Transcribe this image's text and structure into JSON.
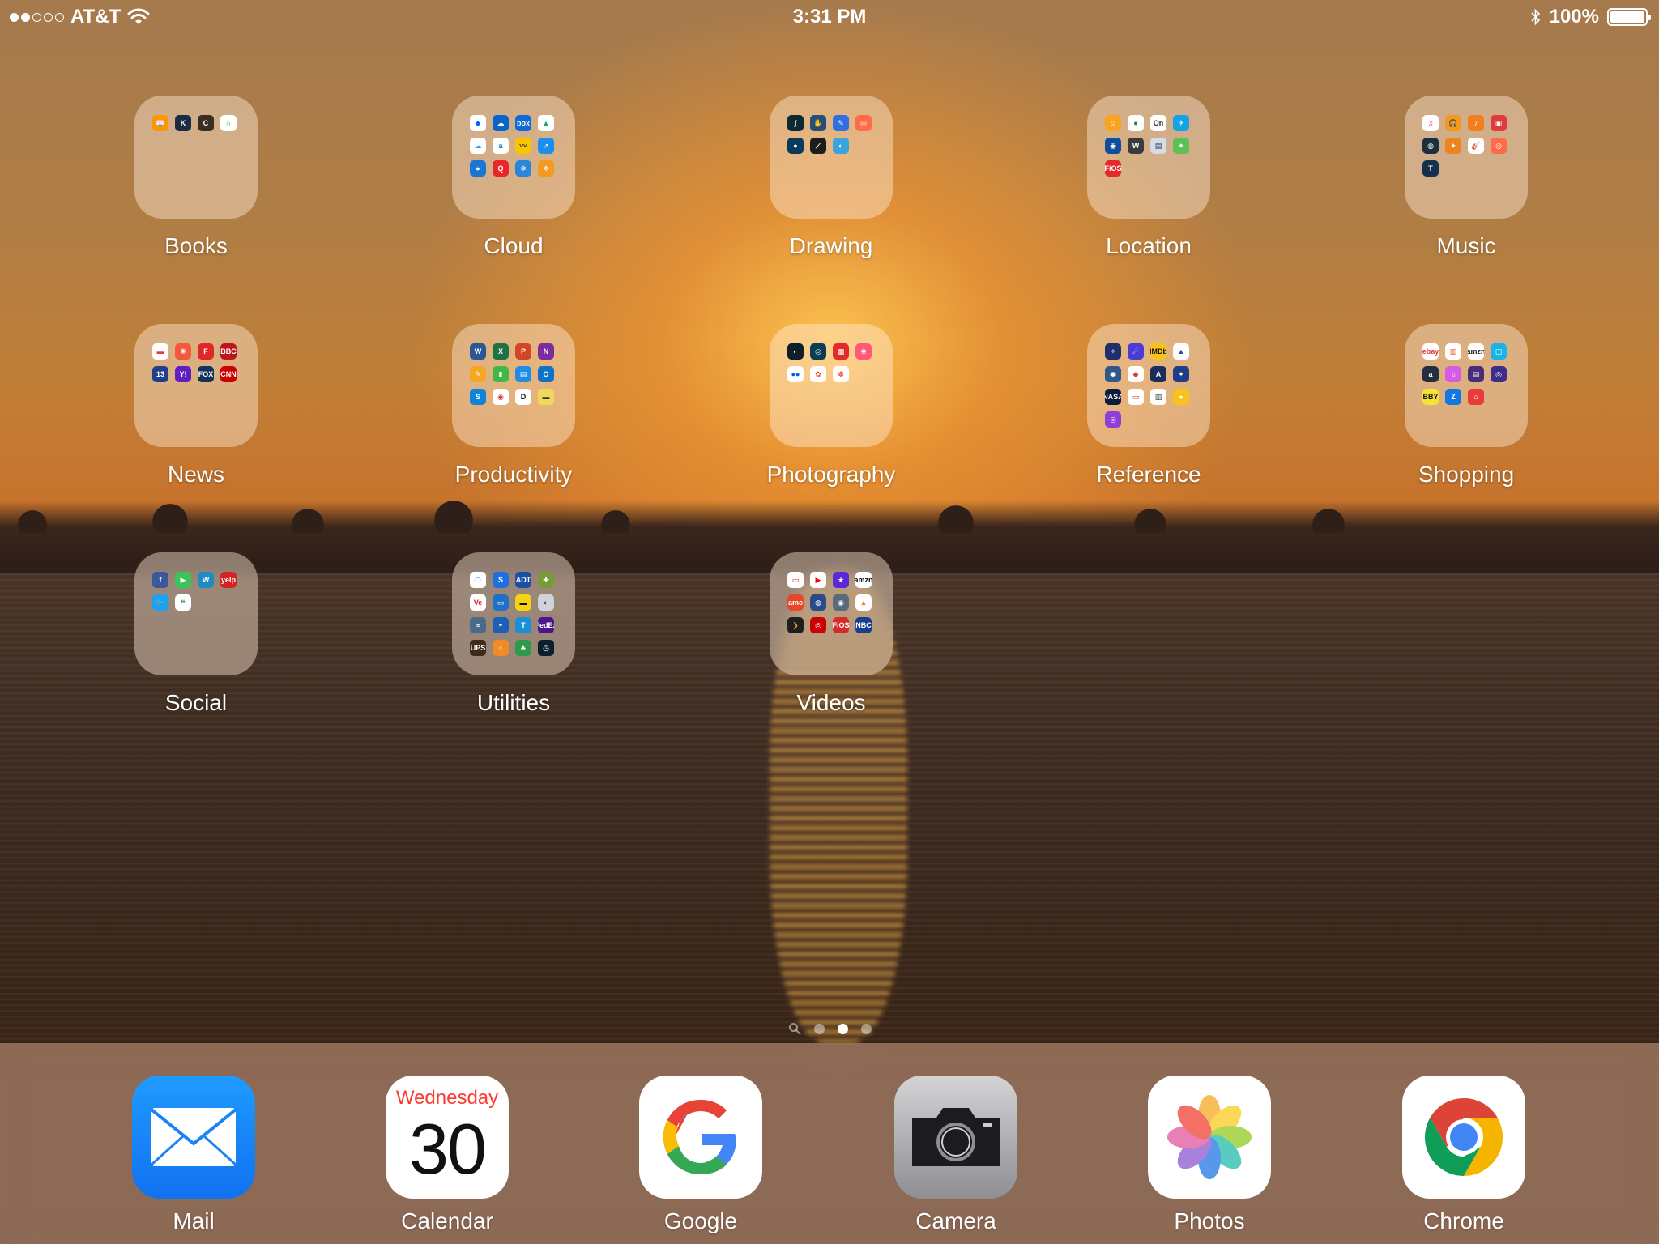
{
  "status_bar": {
    "carrier": "AT&T",
    "time": "3:31 PM",
    "battery": "100%",
    "signal_bars_filled": 2,
    "signal_bars_total": 5
  },
  "folders": [
    {
      "label": "Books",
      "apps": [
        {
          "icon": "books-icon",
          "color": "#ff9500",
          "glyph": "📖"
        },
        {
          "icon": "kindle-icon",
          "color": "#1a2b46",
          "glyph": "K"
        },
        {
          "icon": "comics-icon",
          "color": "#3a2e22",
          "glyph": "C"
        },
        {
          "icon": "nook-icon",
          "color": "#ffffff",
          "fg": "#39a34a",
          "glyph": "∩"
        }
      ]
    },
    {
      "label": "Cloud",
      "apps": [
        {
          "icon": "dropbox-icon",
          "color": "#ffffff",
          "fg": "#0061ff",
          "glyph": "◆"
        },
        {
          "icon": "onedrive-icon",
          "color": "#0a64c8",
          "glyph": "☁"
        },
        {
          "icon": "box-icon",
          "color": "#0e6bd6",
          "glyph": "box"
        },
        {
          "icon": "google-drive-icon",
          "color": "#ffffff",
          "fg": "#1da462",
          "glyph": "▲"
        },
        {
          "icon": "icloud-drive-icon",
          "color": "#ffffff",
          "fg": "#3a9bf4",
          "glyph": "☁"
        },
        {
          "icon": "amazon-drive-icon",
          "color": "#ffffff",
          "fg": "#0d79c6",
          "glyph": "a"
        },
        {
          "icon": "mega-icon",
          "color": "#fbc400",
          "fg": "#333",
          "glyph": "〰"
        },
        {
          "icon": "arrow-cloud-icon",
          "color": "#1b8ef0",
          "glyph": "➚"
        },
        {
          "icon": "leaf-icon",
          "color": "#1976d2",
          "glyph": "●"
        },
        {
          "icon": "quip-icon",
          "color": "#e8262c",
          "glyph": "Q"
        },
        {
          "icon": "snowflake-icon",
          "color": "#2a86d9",
          "glyph": "❄"
        },
        {
          "icon": "gear-sync-icon",
          "color": "#f49a23",
          "glyph": "✲"
        }
      ]
    },
    {
      "label": "Drawing",
      "apps": [
        {
          "icon": "adobe-draw-icon",
          "color": "#0b2a33",
          "glyph": "∫"
        },
        {
          "icon": "sketch-icon",
          "color": "#264f78",
          "glyph": "✋"
        },
        {
          "icon": "pencil-icon",
          "color": "#2f6fe0",
          "glyph": "✎"
        },
        {
          "icon": "art-icon",
          "color": "#ff6d48",
          "glyph": "◎"
        },
        {
          "icon": "pin-icon",
          "color": "#0a3a5a",
          "glyph": "●"
        },
        {
          "icon": "brush-icon",
          "color": "#1c1c1c",
          "glyph": "⟋"
        },
        {
          "icon": "paint-icon",
          "color": "#3aa3e0",
          "glyph": "◐"
        }
      ]
    },
    {
      "label": "Location",
      "apps": [
        {
          "icon": "family-icon",
          "color": "#f7a520",
          "glyph": "☺"
        },
        {
          "icon": "find-friends-icon",
          "color": "#ffffff",
          "fg": "#1b8a2a",
          "glyph": "●"
        },
        {
          "icon": "on-icon",
          "color": "#ffffff",
          "fg": "#222",
          "glyph": "On"
        },
        {
          "icon": "flight-icon",
          "color": "#15a3e8",
          "glyph": "✈"
        },
        {
          "icon": "globe-icon",
          "color": "#0f4e9a",
          "glyph": "◉"
        },
        {
          "icon": "waze-icon",
          "color": "#3b3b3b",
          "glyph": "W"
        },
        {
          "icon": "bus-icon",
          "color": "#d2dde8",
          "fg": "#333",
          "glyph": "▤"
        },
        {
          "icon": "maps-icon",
          "color": "#5fbf57",
          "glyph": "⌖"
        },
        {
          "icon": "myfios-icon",
          "color": "#e22a2a",
          "glyph": "FiOS"
        }
      ]
    },
    {
      "label": "Music",
      "apps": [
        {
          "icon": "music-icon",
          "color": "#ffffff",
          "fg": "#fb3c5a",
          "glyph": "♫"
        },
        {
          "icon": "headphones-icon",
          "color": "#f39a1d",
          "glyph": "🎧"
        },
        {
          "icon": "garageband-icon",
          "color": "#f47d1e",
          "glyph": "♪"
        },
        {
          "icon": "radio-icon",
          "color": "#e03a3a",
          "glyph": "▣"
        },
        {
          "icon": "speaker-icon",
          "color": "#1b2f3f",
          "glyph": "◍"
        },
        {
          "icon": "guitar-icon",
          "color": "#ec8521",
          "glyph": "✦"
        },
        {
          "icon": "guitar-tuner-icon",
          "color": "#ffffff",
          "fg": "#e64a2b",
          "glyph": "🎸"
        },
        {
          "icon": "instagram-music-icon",
          "color": "#ff6a4a",
          "glyph": "◎"
        },
        {
          "icon": "tunein-icon",
          "color": "#15304a",
          "glyph": "T"
        }
      ]
    },
    {
      "label": "News",
      "apps": [
        {
          "icon": "news-paper-icon",
          "color": "#ffffff",
          "fg": "#e53a3a",
          "glyph": "▬"
        },
        {
          "icon": "news-icon",
          "color": "#f7573b",
          "glyph": "✺"
        },
        {
          "icon": "flipboard-icon",
          "color": "#e12828",
          "glyph": "F"
        },
        {
          "icon": "bbc-news-icon",
          "color": "#bb1919",
          "glyph": "BBC"
        },
        {
          "icon": "fox13-icon",
          "color": "#1f3f8e",
          "glyph": "13"
        },
        {
          "icon": "yahoo-icon",
          "color": "#5f1ec0",
          "glyph": "Y!"
        },
        {
          "icon": "fox-news-icon",
          "color": "#10325c",
          "glyph": "FOX"
        },
        {
          "icon": "cnn-icon",
          "color": "#cc0000",
          "glyph": "CNN"
        }
      ]
    },
    {
      "label": "Productivity",
      "apps": [
        {
          "icon": "word-icon",
          "color": "#2b5797",
          "glyph": "W"
        },
        {
          "icon": "excel-icon",
          "color": "#1f7244",
          "glyph": "X"
        },
        {
          "icon": "powerpoint-icon",
          "color": "#d24625",
          "glyph": "P"
        },
        {
          "icon": "onenote-icon",
          "color": "#7b2e9b",
          "glyph": "N"
        },
        {
          "icon": "pages-icon",
          "color": "#f5a623",
          "glyph": "✎"
        },
        {
          "icon": "numbers-icon",
          "color": "#3fb845",
          "glyph": "▮"
        },
        {
          "icon": "keynote-icon",
          "color": "#1f8ce6",
          "glyph": "▤"
        },
        {
          "icon": "outlook-icon",
          "color": "#0e72c7",
          "glyph": "O"
        },
        {
          "icon": "skype-icon",
          "color": "#0e84d9",
          "glyph": "S"
        },
        {
          "icon": "speaker-deck-icon",
          "color": "#ffffff",
          "fg": "#d8262c",
          "glyph": "◉"
        },
        {
          "icon": "d-icon",
          "color": "#ffffff",
          "fg": "#111",
          "glyph": "D"
        },
        {
          "icon": "scanner-icon",
          "color": "#f0d85a",
          "fg": "#333",
          "glyph": "▬"
        }
      ]
    },
    {
      "label": "Photography",
      "apps": [
        {
          "icon": "lens-icon",
          "color": "#0d1f2a",
          "glyph": "◐"
        },
        {
          "icon": "camera-plus-icon",
          "color": "#0b3d54",
          "glyph": "◎"
        },
        {
          "icon": "photo-booth-icon",
          "color": "#e22a2a",
          "glyph": "▦"
        },
        {
          "icon": "collage-icon",
          "color": "#ff5a7a",
          "glyph": "❀"
        },
        {
          "icon": "flickr-icon",
          "color": "#ffffff",
          "fg": "#0063dc",
          "glyph": "●●"
        },
        {
          "icon": "google-photos-icon",
          "color": "#ffffff",
          "fg": "#ea4335",
          "glyph": "✿"
        },
        {
          "icon": "flower-icon",
          "color": "#ffffff",
          "fg": "#f04a2a",
          "glyph": "✽"
        }
      ]
    },
    {
      "label": "Reference",
      "apps": [
        {
          "icon": "star-walk-icon",
          "color": "#1f2f6b",
          "glyph": "✧"
        },
        {
          "icon": "space-icon",
          "color": "#4a3bd6",
          "glyph": "☄"
        },
        {
          "icon": "imdb-icon",
          "color": "#f5c518",
          "fg": "#111",
          "glyph": "IMDb"
        },
        {
          "icon": "navigation-icon",
          "color": "#ffffff",
          "fg": "#1d4e9a",
          "glyph": "▲"
        },
        {
          "icon": "planet-icon",
          "color": "#2d5a8a",
          "glyph": "◉"
        },
        {
          "icon": "car-icon",
          "color": "#ffffff",
          "fg": "#d33",
          "glyph": "◆"
        },
        {
          "icon": "astronaut-icon",
          "color": "#1c2d5c",
          "glyph": "A"
        },
        {
          "icon": "night-sky-icon",
          "color": "#1e3d8a",
          "glyph": "✦"
        },
        {
          "icon": "nasa-icon",
          "color": "#0b1c3c",
          "glyph": "NASA"
        },
        {
          "icon": "tv-guide-icon",
          "color": "#ffffff",
          "fg": "#d22",
          "glyph": "▭"
        },
        {
          "icon": "dictionary-icon",
          "color": "#ffffff",
          "fg": "#333",
          "glyph": "▥"
        },
        {
          "icon": "tips-icon",
          "color": "#f7c21a",
          "glyph": "●"
        },
        {
          "icon": "podcasts-icon",
          "color": "#8e3fd8",
          "glyph": "◎"
        }
      ]
    },
    {
      "label": "Shopping",
      "apps": [
        {
          "icon": "ebay-icon",
          "color": "#ffffff",
          "fg": "#e53238",
          "glyph": "ebay"
        },
        {
          "icon": "barcode-icon",
          "color": "#ffffff",
          "fg": "#e53",
          "glyph": "▥"
        },
        {
          "icon": "amazon-icon",
          "color": "#ffffff",
          "fg": "#222",
          "glyph": "amzn"
        },
        {
          "icon": "app-store-bag-icon",
          "color": "#1ab3e8",
          "glyph": "▢"
        },
        {
          "icon": "amazon-a-icon",
          "color": "#232f3e",
          "glyph": "a"
        },
        {
          "icon": "itunes-icon",
          "color": "#d55ae6",
          "glyph": "♫"
        },
        {
          "icon": "ticket-icon",
          "color": "#4a2d7a",
          "glyph": "▤"
        },
        {
          "icon": "shop-icon",
          "color": "#3d2c8a",
          "glyph": "◎"
        },
        {
          "icon": "best-buy-icon",
          "color": "#f5e33a",
          "fg": "#111",
          "glyph": "BBY"
        },
        {
          "icon": "zillow-icon",
          "color": "#1277e1",
          "glyph": "Z"
        },
        {
          "icon": "home-depot-icon",
          "color": "#ea3a3a",
          "glyph": "⌂"
        }
      ]
    },
    {
      "label": "Social",
      "apps": [
        {
          "icon": "facebook-icon",
          "color": "#3b5998",
          "glyph": "f"
        },
        {
          "icon": "facetime-icon",
          "color": "#3ac45a",
          "glyph": "▶"
        },
        {
          "icon": "wordpress-icon",
          "color": "#1e8cbe",
          "glyph": "W"
        },
        {
          "icon": "yelp-icon",
          "color": "#d32323",
          "glyph": "yelp"
        },
        {
          "icon": "twitter-icon",
          "color": "#1da1f2",
          "glyph": "🐦"
        },
        {
          "icon": "hangouts-icon",
          "color": "#ffffff",
          "fg": "#0f9d58",
          "glyph": "❝"
        }
      ]
    },
    {
      "label": "Utilities",
      "apps": [
        {
          "icon": "wifi-icon",
          "color": "#ffffff",
          "fg": "#1a7fe0",
          "glyph": "◠"
        },
        {
          "icon": "shazam-icon",
          "color": "#1e6fe0",
          "glyph": "S"
        },
        {
          "icon": "adt-icon",
          "color": "#1a4fa3",
          "glyph": "ADT"
        },
        {
          "icon": "puzzle-icon",
          "color": "#7a9a3a",
          "glyph": "✚"
        },
        {
          "icon": "verizon-icon",
          "color": "#ffffff",
          "fg": "#d22",
          "glyph": "Ve"
        },
        {
          "icon": "keyboard-icon",
          "color": "#1f70c8",
          "glyph": "▭"
        },
        {
          "icon": "truck-icon",
          "color": "#f5d312",
          "fg": "#111",
          "glyph": "▬"
        },
        {
          "icon": "find-phone-icon",
          "color": "#cfd4da",
          "fg": "#333",
          "glyph": "◐"
        },
        {
          "icon": "binoculars-icon",
          "color": "#4a6a8a",
          "glyph": "∞"
        },
        {
          "icon": "weather-icon",
          "color": "#1c5fb4",
          "glyph": "◓"
        },
        {
          "icon": "text-icon",
          "color": "#1a8ed6",
          "glyph": "T"
        },
        {
          "icon": "fedex-icon",
          "color": "#4d148c",
          "glyph": "FedEx"
        },
        {
          "icon": "ups-icon",
          "color": "#3e2b1a",
          "glyph": "UPS"
        },
        {
          "icon": "home-icon",
          "color": "#f08a24",
          "glyph": "⌂"
        },
        {
          "icon": "tree-icon",
          "color": "#2c9a4a",
          "glyph": "♣"
        },
        {
          "icon": "speedtest-icon",
          "color": "#0b1f2e",
          "glyph": "◷"
        }
      ]
    },
    {
      "label": "Videos",
      "apps": [
        {
          "icon": "tv-icon",
          "color": "#ffffff",
          "fg": "#e22",
          "glyph": "▭"
        },
        {
          "icon": "youtube-icon",
          "color": "#ffffff",
          "fg": "#f00",
          "glyph": "▶"
        },
        {
          "icon": "itunes-movies-icon",
          "color": "#5a2ad8",
          "glyph": "★"
        },
        {
          "icon": "amazon-video-icon",
          "color": "#ffffff",
          "fg": "#111",
          "glyph": "amzn"
        },
        {
          "icon": "amc-icon",
          "color": "#e6462a",
          "glyph": "amc"
        },
        {
          "icon": "popcorn-icon",
          "color": "#2a4a8a",
          "glyph": "◍"
        },
        {
          "icon": "reel-icon",
          "color": "#5a6a7a",
          "glyph": "◉"
        },
        {
          "icon": "vlc-icon",
          "color": "#ffffff",
          "fg": "#f58220",
          "glyph": "▲"
        },
        {
          "icon": "plex-icon",
          "color": "#1f1f1f",
          "fg": "#e5a00d",
          "glyph": "❯"
        },
        {
          "icon": "target-icon",
          "color": "#cc0000",
          "glyph": "◎"
        },
        {
          "icon": "fios-tv-icon",
          "color": "#d62a2a",
          "glyph": "FiOS"
        },
        {
          "icon": "nbc-sports-icon",
          "color": "#1a3e8e",
          "glyph": "NBC"
        }
      ]
    }
  ],
  "page_dots": {
    "count": 3,
    "active_index": 1
  },
  "dock": [
    {
      "label": "Mail",
      "icon": "mail-icon"
    },
    {
      "label": "Calendar",
      "icon": "calendar-icon",
      "weekday": "Wednesday",
      "day": "30"
    },
    {
      "label": "Google",
      "icon": "google-icon"
    },
    {
      "label": "Camera",
      "icon": "camera-icon"
    },
    {
      "label": "Photos",
      "icon": "photos-icon"
    },
    {
      "label": "Chrome",
      "icon": "chrome-icon"
    }
  ]
}
